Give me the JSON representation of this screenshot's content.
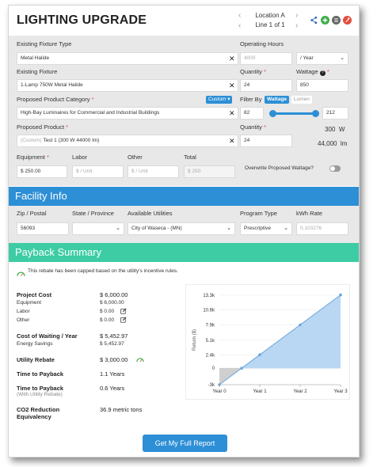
{
  "header": {
    "title": "LIGHTING UPGRADE",
    "location": "Location A",
    "line": "Line 1 of 1",
    "icons": [
      "share-icon",
      "add-icon",
      "list-icon",
      "settings-icon"
    ],
    "colors": {
      "share": "#3b6fb6",
      "add": "#3fae49",
      "list": "#666666",
      "settings": "#e74c3c"
    }
  },
  "fixture": {
    "existing_type_label": "Existing Fixture Type",
    "existing_type_value": "Metal Halide",
    "operating_hours_label": "Operating Hours",
    "operating_hours_placeholder": "4000",
    "per_year": "/ Year",
    "existing_fixture_label": "Existing Fixture",
    "existing_fixture_value": "1-Lamp 750W Metal Halide",
    "quantity_label": "Quantity",
    "existing_quantity": "24",
    "wattage_label": "Wattage",
    "existing_wattage": "850",
    "category_label": "Proposed Product Category",
    "custom_badge": "Custom",
    "category_value": "High-Bay Luminaires for Commercial and Industrial Buildings",
    "filter_by_label": "Filter By",
    "filter_wattage": "Wattage",
    "filter_lumen": "Lumen",
    "filter_min": "82",
    "filter_max": "212",
    "product_label": "Proposed Product",
    "product_prefix": "(Custom)",
    "product_value": "Test 1 (300 W 44000 lm)",
    "proposed_quantity": "24",
    "proposed_watts": "300",
    "watts_unit": "W",
    "proposed_lumens": "44,000",
    "lumens_unit": "lm",
    "equipment_label": "Equipment",
    "equipment_value": "$ 250.00",
    "labor_label": "Labor",
    "labor_placeholder": "$ / Unit",
    "other_label": "Other",
    "other_placeholder": "$ / Unit",
    "total_label": "Total",
    "total_value": "$ 250",
    "overwrite_label": "Overwrite Proposed Wattage?"
  },
  "facility": {
    "title": "Facility Info",
    "zip_label": "Zip / Postal",
    "zip_value": "56093",
    "state_label": "State / Province",
    "utilities_label": "Available Utilities",
    "utility_value": "City of Waseca - (MN)",
    "program_label": "Program Type",
    "program_value": "Prescriptive",
    "kwh_label": "kWh Rate",
    "kwh_placeholder": "0.103276",
    "color": "#2d8fd6"
  },
  "payback": {
    "title": "Payback Summary",
    "color": "#3dcca4",
    "note": "This rebate has been capped based on the utility's incentive rules.",
    "project_cost_label": "Project Cost",
    "project_cost_value": "$ 6,000.00",
    "equipment_label": "Equipment",
    "equipment_value": "$ 6,000.00",
    "labor_label": "Labor",
    "labor_value": "$ 0.00",
    "other_label": "Other",
    "other_value": "$ 0.00",
    "waiting_label": "Cost of Waiting / Year",
    "waiting_value": "$ 5,452.97",
    "energy_label": "Energy Savings",
    "energy_value": "$ 5,452.97",
    "rebate_label": "Utility Rebate",
    "rebate_value": "$ 3,000.00",
    "payback_label": "Time to Payback",
    "payback_value": "1.1 Years",
    "payback_rebate_label": "Time to Payback",
    "payback_rebate_sub": "(With Utility Rebate)",
    "payback_rebate_value": "0.6 Years",
    "co2_label_1": "CO2 Reduction",
    "co2_label_2": "Equivalency",
    "co2_value": "36.9 metric tons",
    "report_button": "Get My Full Report"
  },
  "chart_data": {
    "type": "area",
    "categories": [
      "Year 0",
      "Year 1",
      "Year 2",
      "Year 3"
    ],
    "x": [
      0,
      0.55,
      1,
      2,
      3
    ],
    "y": [
      -3000,
      0,
      2453,
      7906,
      13359
    ],
    "ylabel": "Return ($)",
    "yticks": [
      "13.3k",
      "10.6k",
      "7.9k",
      "5.1k",
      "2.4k",
      "0",
      "-3k"
    ],
    "ytick_values": [
      13300,
      10600,
      7900,
      5100,
      2400,
      0,
      -3000
    ],
    "ylim": [
      -3000,
      13300
    ],
    "grid": true,
    "positive_fill": "#b9d7f3",
    "negative_fill": "#cfcfcf",
    "line_color": "#6aa7dd"
  }
}
